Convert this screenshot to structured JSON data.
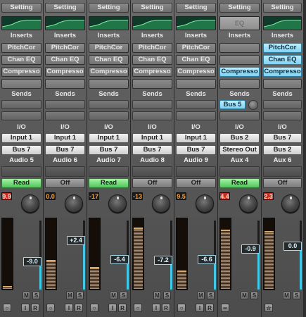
{
  "colors": {
    "active_slot": "#7fd2f2",
    "read_green": "#4fc65a",
    "fader_level": "#42c9e8",
    "peak_red": "#c52b1f"
  },
  "labels": {
    "setting": "Setting",
    "inserts": "Inserts",
    "sends": "Sends",
    "io": "I/O",
    "mute": "M",
    "solo": "S",
    "input_monitor": "I",
    "record": "R"
  },
  "strips": [
    {
      "eq_thumb": true,
      "eq_label": "",
      "inserts": [
        {
          "label": "PitchCor",
          "active": false
        },
        {
          "label": "Chan EQ",
          "active": false
        },
        {
          "label": "Compresso",
          "active": false
        },
        {
          "label": "",
          "active": false
        }
      ],
      "send": "",
      "input": "Input 1",
      "output": "Bus 7",
      "name": "Audio 5",
      "automation": "Read",
      "auto_read": true,
      "peak": "9.9",
      "peak_color": "#c52b1f",
      "meter_level": 0.03,
      "fader_value": "-9.0",
      "fader_level": 0.4,
      "bottom": "icon-rec",
      "rec": true
    },
    {
      "eq_thumb": true,
      "eq_label": "",
      "inserts": [
        {
          "label": "PitchCor",
          "active": false
        },
        {
          "label": "Chan EQ",
          "active": false
        },
        {
          "label": "Compresso",
          "active": false
        },
        {
          "label": "",
          "active": false
        }
      ],
      "send": "",
      "input": "Input 1",
      "output": "Bus 7",
      "name": "Audio 6",
      "automation": "Off",
      "auto_read": false,
      "peak": "0.0",
      "peak_color": "#e87a2a",
      "meter_level": 0.4,
      "fader_value": "+2.4",
      "fader_level": 0.7,
      "bottom": "icon-rec",
      "rec": true
    },
    {
      "eq_thumb": true,
      "eq_label": "",
      "inserts": [
        {
          "label": "PitchCor",
          "active": false
        },
        {
          "label": "Chan EQ",
          "active": false
        },
        {
          "label": "Compresso",
          "active": false
        },
        {
          "label": "",
          "active": false
        }
      ],
      "send": "",
      "input": "Input 1",
      "output": "Bus 7",
      "name": "Audio 7",
      "automation": "Read",
      "auto_read": true,
      "peak": "-17",
      "peak_color": "#e87a2a",
      "meter_level": 0.3,
      "fader_value": "-6.4",
      "fader_level": 0.43,
      "bottom": "icon-rec",
      "rec": true
    },
    {
      "eq_thumb": true,
      "eq_label": "",
      "inserts": [
        {
          "label": "PitchCor",
          "active": false
        },
        {
          "label": "Chan EQ",
          "active": false
        },
        {
          "label": "Compresso",
          "active": false
        },
        {
          "label": "",
          "active": false
        }
      ],
      "send": "",
      "input": "Input 1",
      "output": "Bus 7",
      "name": "Audio 8",
      "automation": "Off",
      "auto_read": false,
      "peak": "-13",
      "peak_color": "#e87a2a",
      "meter_level": 0.85,
      "fader_value": "-7.2",
      "fader_level": 0.42,
      "bottom": "icon-rec",
      "rec": true
    },
    {
      "eq_thumb": true,
      "eq_label": "",
      "inserts": [
        {
          "label": "PitchCor",
          "active": false
        },
        {
          "label": "Chan EQ",
          "active": false
        },
        {
          "label": "Compresso",
          "active": false
        },
        {
          "label": "",
          "active": false
        }
      ],
      "send": "",
      "input": "Input 1",
      "output": "Bus 7",
      "name": "Audio 9",
      "automation": "Off",
      "auto_read": false,
      "peak": "9.5",
      "peak_color": "#e87a2a",
      "meter_level": 0.25,
      "fader_value": "-6.6",
      "fader_level": 0.43,
      "bottom": "icon-rec",
      "rec": true
    },
    {
      "eq_thumb": false,
      "eq_label": "EQ",
      "inserts": [
        {
          "label": "",
          "active": false
        },
        {
          "label": "",
          "active": false
        },
        {
          "label": "Compresso",
          "active": true
        },
        {
          "label": "",
          "active": false
        }
      ],
      "send": "Bus 5",
      "input": "Bus 2",
      "output": "Stereo Out",
      "name": "Aux 4",
      "automation": "Read",
      "auto_read": true,
      "peak": "4.4",
      "peak_color": "#c52b1f",
      "meter_level": 0.82,
      "fader_value": "-0.9",
      "fader_level": 0.58,
      "bottom": "link-icon",
      "rec": false
    },
    {
      "eq_thumb": true,
      "eq_label": "",
      "inserts": [
        {
          "label": "PitchCor",
          "active": true
        },
        {
          "label": "Chan EQ",
          "active": true
        },
        {
          "label": "Compresso",
          "active": true
        },
        {
          "label": "",
          "active": false
        }
      ],
      "send": "",
      "input": "Bus 7",
      "output": "Bus 2",
      "name": "Aux 6",
      "automation": "Off",
      "auto_read": false,
      "peak": "2.3",
      "peak_color": "#c52b1f",
      "meter_level": 0.8,
      "fader_value": "0.0",
      "fader_level": 0.62,
      "bottom": "star-icon",
      "rec": false
    }
  ]
}
